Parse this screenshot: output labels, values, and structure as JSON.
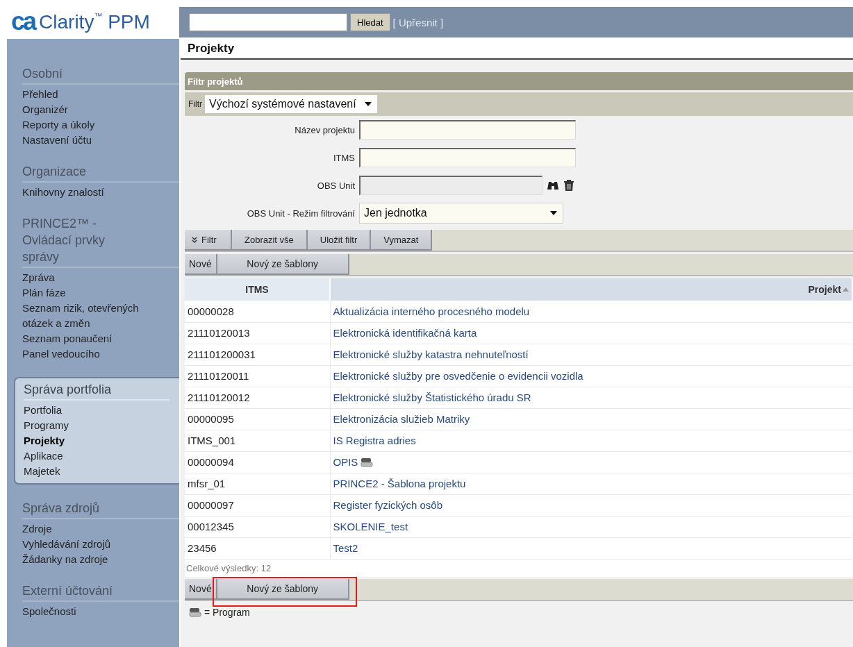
{
  "header": {
    "logo_mark": "ca",
    "product": "Clarity$^{™}$ PPM",
    "search_button": "Hledat",
    "advanced_link": "[ Upřesnit ]"
  },
  "sidebar": {
    "sections": [
      {
        "title": "Osobní",
        "highlighted": false,
        "items": [
          {
            "label": "Přehled",
            "selected": false
          },
          {
            "label": "Organizér",
            "selected": false
          },
          {
            "label": "Reporty a úkoly",
            "selected": false
          },
          {
            "label": "Nastavení účtu",
            "selected": false
          }
        ]
      },
      {
        "title": "Organizace",
        "highlighted": false,
        "items": [
          {
            "label": "Knihovny znalostí",
            "selected": false
          }
        ]
      },
      {
        "title": "PRINCE2™ - Ovládací prvky správy",
        "highlighted": false,
        "items": [
          {
            "label": "Zpráva",
            "selected": false
          },
          {
            "label": "Plán fáze",
            "selected": false
          },
          {
            "label": "Seznam rizik, otevřených otázek a změn",
            "selected": false
          },
          {
            "label": "Seznam ponaučení",
            "selected": false
          },
          {
            "label": "Panel vedoucího",
            "selected": false
          }
        ]
      },
      {
        "title": "Správa portfolia",
        "highlighted": true,
        "items": [
          {
            "label": "Portfolia",
            "selected": false
          },
          {
            "label": "Programy",
            "selected": false
          },
          {
            "label": "Projekty",
            "selected": true
          },
          {
            "label": "Aplikace",
            "selected": false
          },
          {
            "label": "Majetek",
            "selected": false
          }
        ]
      },
      {
        "title": "Správa zdrojů",
        "highlighted": false,
        "items": [
          {
            "label": "Zdroje",
            "selected": false
          },
          {
            "label": "Vyhledávání zdrojů",
            "selected": false
          },
          {
            "label": "Žádanky na zdroje",
            "selected": false
          }
        ]
      },
      {
        "title": "Externí účtování",
        "highlighted": false,
        "items": [
          {
            "label": "Společnosti",
            "selected": false
          }
        ]
      }
    ]
  },
  "page_title": "Projekty",
  "filter": {
    "title": "Filtr projektů",
    "filter_label": "Filtr",
    "filter_select": "Výchozí systémové nastavení",
    "fields": [
      {
        "kind": "text",
        "label": "Název projektu",
        "disabled": false
      },
      {
        "kind": "text",
        "label": "ITMS",
        "disabled": false
      },
      {
        "kind": "lookup",
        "label": "OBS Unit",
        "disabled": true
      },
      {
        "kind": "select",
        "label": "OBS Unit - Režim filtrování",
        "value": "Jen jednotka",
        "disabled": false
      }
    ],
    "buttons": [
      {
        "kind": "toggle",
        "label": "Filtr"
      },
      {
        "kind": "plain",
        "label": "Zobrazit vše"
      },
      {
        "kind": "plain",
        "label": "Uložit filtr"
      },
      {
        "kind": "plain",
        "label": "Vymazat"
      }
    ]
  },
  "actions_top": [
    {
      "label": "Nové",
      "highlighted": false
    },
    {
      "label": "Nový ze šablony",
      "highlighted": false
    }
  ],
  "table": {
    "columns": [
      {
        "label": "ITMS",
        "sorted": false
      },
      {
        "label": "Projekt",
        "sorted": true
      }
    ],
    "rows": [
      {
        "itms": "00000028",
        "project": "Aktualizácia interného procesného modelu",
        "is_program": false
      },
      {
        "itms": "21110120013",
        "project": "Elektronická identifikačná karta",
        "is_program": false
      },
      {
        "itms": "211101200031",
        "project": "Elektronické služby katastra nehnuteľností",
        "is_program": false
      },
      {
        "itms": "21110120011",
        "project": "Elektronické služby pre osvedčenie o evidencii vozidla",
        "is_program": false
      },
      {
        "itms": "21110120012",
        "project": "Elektronické služby Štatistického úradu SR",
        "is_program": false
      },
      {
        "itms": "00000095",
        "project": "Elektronizácia služieb Matriky",
        "is_program": false
      },
      {
        "itms": "ITMS_001",
        "project": "IS Registra adries",
        "is_program": false
      },
      {
        "itms": "00000094",
        "project": "OPIS",
        "is_program": true
      },
      {
        "itms": "mfsr_01",
        "project": "PRINCE2 - Šablona projektu",
        "is_program": false
      },
      {
        "itms": "00000097",
        "project": "Register fyzických osôb",
        "is_program": false
      },
      {
        "itms": "00012345",
        "project": "SKOLENIE_test",
        "is_program": false
      },
      {
        "itms": "23456",
        "project": "Test2",
        "is_program": false
      }
    ]
  },
  "total": "Celkové výsledky: 12",
  "actions_bottom": [
    {
      "label": "Nové",
      "highlighted": false
    },
    {
      "label": "Nový ze šablony",
      "highlighted": true
    }
  ],
  "legend": {
    "label": "= Program"
  }
}
